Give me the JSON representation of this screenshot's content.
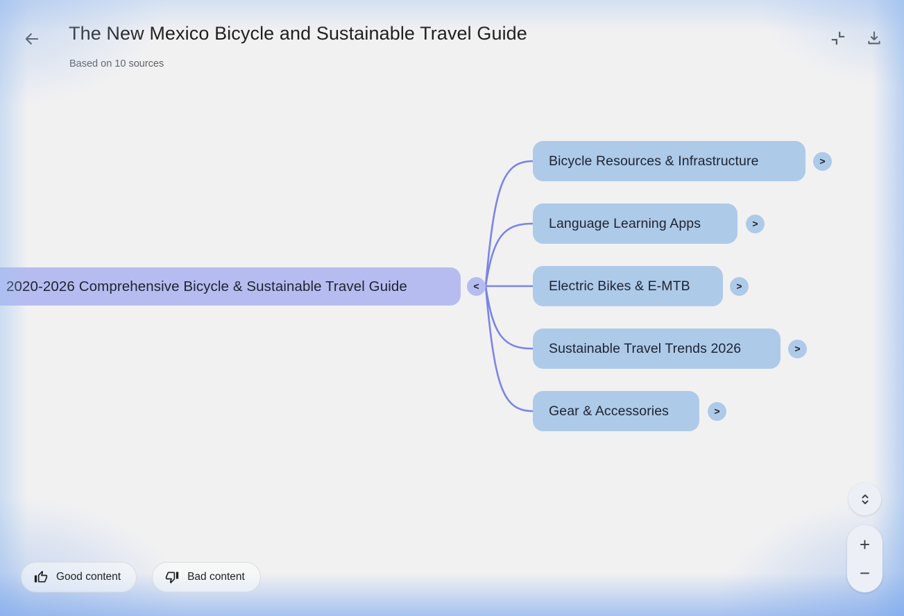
{
  "header": {
    "title": "The New Mexico Bicycle and Sustainable Travel Guide",
    "subtitle": "Based on 10 sources",
    "back_icon": "arrow-left",
    "action_icons": [
      "collapse-content",
      "download"
    ]
  },
  "mindmap": {
    "root": {
      "label": "2020-2026 Comprehensive Bicycle & Sustainable Travel Guide",
      "collapse_glyph": "<"
    },
    "children": [
      {
        "label": "Bicycle Resources & Infrastructure",
        "expand_glyph": ">"
      },
      {
        "label": "Language Learning Apps",
        "expand_glyph": ">"
      },
      {
        "label": "Electric Bikes & E-MTB",
        "expand_glyph": ">"
      },
      {
        "label": "Sustainable Travel Trends 2026",
        "expand_glyph": ">"
      },
      {
        "label": "Gear & Accessories",
        "expand_glyph": ">"
      }
    ],
    "colors": {
      "root_fill": "#b7bcf0",
      "child_fill": "#aecae9",
      "connector": "#7b84e6",
      "node_text": "#1d2330",
      "edge_glow": "#a9c4ee"
    }
  },
  "feedback": {
    "good_label": "Good content",
    "bad_label": "Bad content"
  },
  "zoom_controls": {
    "zoom_in_glyph": "+",
    "zoom_out_glyph": "−"
  }
}
